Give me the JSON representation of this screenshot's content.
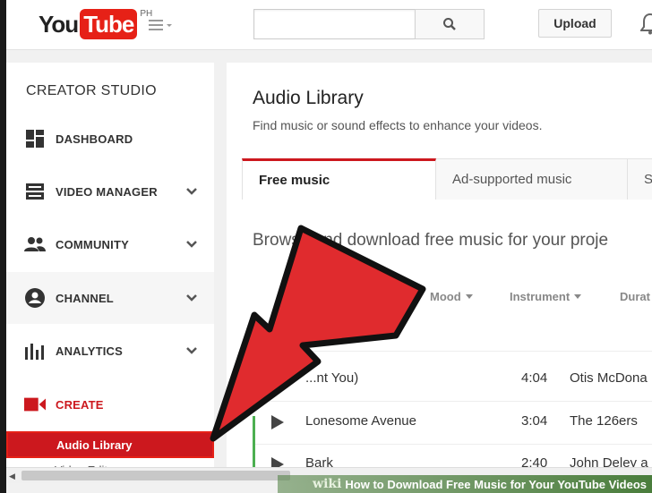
{
  "header": {
    "logo_you": "You",
    "logo_tube": "Tube",
    "logo_region": "PH",
    "search_placeholder": "",
    "upload_label": "Upload"
  },
  "sidebar": {
    "title": "CREATOR STUDIO",
    "items": [
      {
        "label": "DASHBOARD",
        "icon": "dashboard-icon"
      },
      {
        "label": "VIDEO MANAGER",
        "icon": "video-manager-icon"
      },
      {
        "label": "COMMUNITY",
        "icon": "community-icon"
      },
      {
        "label": "CHANNEL",
        "icon": "channel-icon"
      },
      {
        "label": "ANALYTICS",
        "icon": "analytics-icon"
      },
      {
        "label": "CREATE",
        "icon": "camera-icon"
      }
    ],
    "sub_active": "Audio Library",
    "sub_next": "Video Edit..."
  },
  "main": {
    "title": "Audio Library",
    "subtitle": "Find music or sound effects to enhance your videos.",
    "tabs": [
      "Free music",
      "Ad-supported music",
      "S"
    ],
    "browse_text": "Browse and download free music for your proje",
    "filters": [
      "Mood",
      "Instrument",
      "Durat"
    ],
    "tracks": [
      {
        "name": "...nt You)",
        "duration": "4:04",
        "artist": "Otis McDona"
      },
      {
        "name": "Lonesome Avenue",
        "duration": "3:04",
        "artist": "The 126ers"
      },
      {
        "name": "Bark",
        "duration": "2:40",
        "artist": "John Deley a"
      }
    ]
  },
  "footer": {
    "brand": "wiki",
    "text": "How to Download Free Music for Your YouTube Videos"
  },
  "colors": {
    "accent_red": "#cc181e",
    "arrow_red": "#e02b2e",
    "footer_green": "#4a7d3c"
  }
}
